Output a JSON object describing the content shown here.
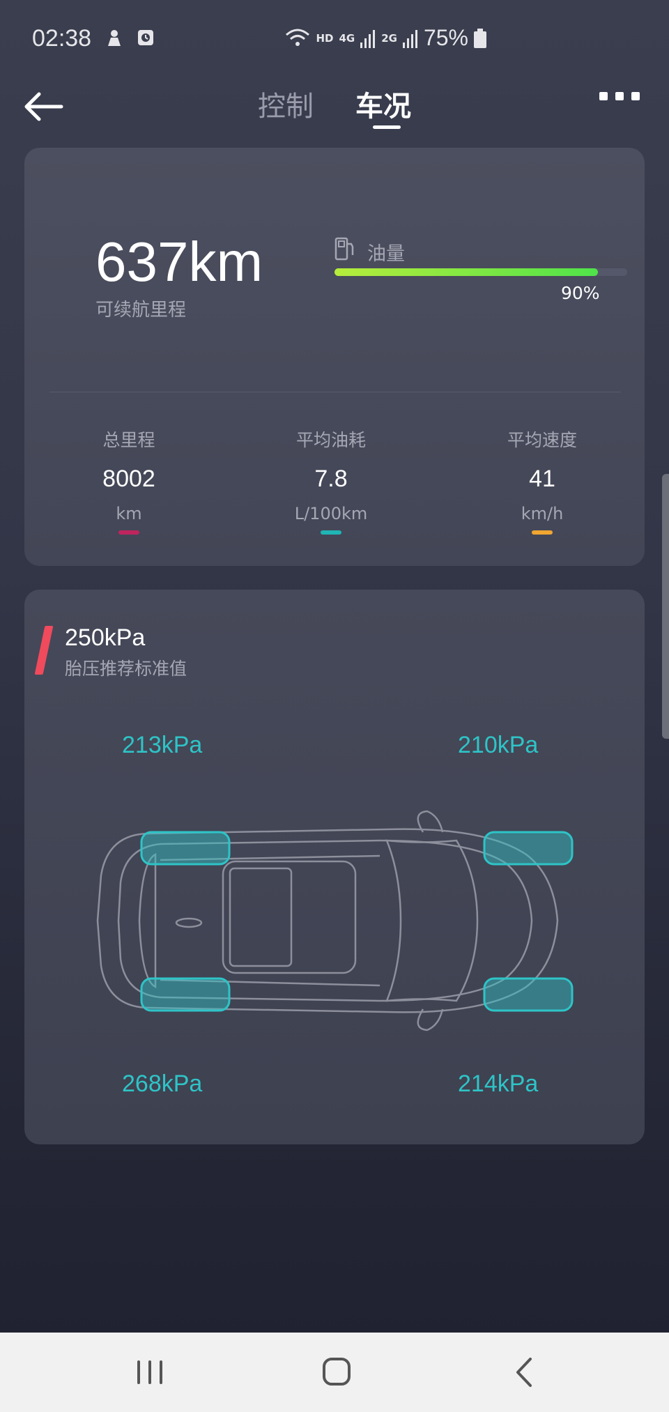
{
  "status_bar": {
    "time": "02:38",
    "network_hd": "HD",
    "network_4g": "4G",
    "network_2g": "2G",
    "battery": "75%"
  },
  "header": {
    "tabs": [
      {
        "label": "控制",
        "active": false
      },
      {
        "label": "车况",
        "active": true
      }
    ]
  },
  "range_card": {
    "range_value": "637km",
    "range_label": "可续航里程",
    "fuel_label": "油量",
    "fuel_percent_text": "90%",
    "fuel_fraction": 0.9,
    "stats": [
      {
        "title": "总里程",
        "value": "8002",
        "unit": "km",
        "color": "#c0245e"
      },
      {
        "title": "平均油耗",
        "value": "7.8",
        "unit": "L/100km",
        "color": "#1fb5b5"
      },
      {
        "title": "平均速度",
        "value": "41",
        "unit": "km/h",
        "color": "#f0a631"
      }
    ]
  },
  "tire_card": {
    "standard_value": "250kPa",
    "standard_label": "胎压推荐标准值",
    "front_left": "213kPa",
    "front_right": "210kPa",
    "rear_left": "268kPa",
    "rear_right": "214kPa",
    "accent_color": "#2ec4c7",
    "marker_color": "#f04a5d"
  }
}
